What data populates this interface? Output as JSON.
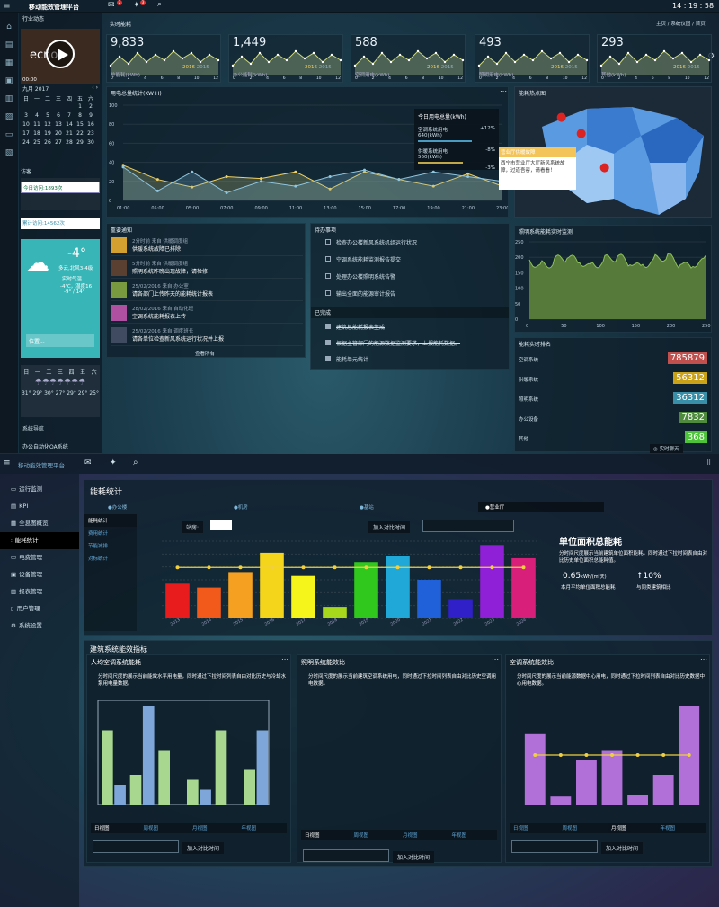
{
  "app": {
    "title": "移动能效管理平台",
    "time": "14 : 19 : 58",
    "mail_badge": "2",
    "sparkle_badge": "3"
  },
  "breadcrumb": {
    "home": "主页",
    "sys": "系统仪图",
    "cur": "首页"
  },
  "left": {
    "news_title": "行业动态",
    "video_time": "00:00",
    "video_label": "ecno",
    "video_sub": "the line",
    "cal_month": "九月 2017",
    "cal_head": [
      "日",
      "一",
      "二",
      "三",
      "四",
      "五",
      "六"
    ],
    "cal_rows": [
      [
        "",
        "",
        "",
        "",
        "",
        "1",
        "2"
      ],
      [
        "3",
        "4",
        "5",
        "6",
        "7",
        "8",
        "9"
      ],
      [
        "10",
        "11",
        "12",
        "13",
        "14",
        "15",
        "16"
      ],
      [
        "17",
        "18",
        "19",
        "20",
        "21",
        "22",
        "23"
      ],
      [
        "24",
        "25",
        "26",
        "27",
        "28",
        "29",
        "30"
      ]
    ],
    "visit_title": "访客",
    "visit_today": "今日访问:1893次",
    "visit_total": "累计访问:14562次",
    "weather_temp": "-4°",
    "weather_wind": "多云,北风3-4级",
    "weather_now": "实时气温",
    "weather_range": "-4℃，湿度16",
    "weather_aqi": "-9° / 14°",
    "location_ph": "位置...",
    "forecast_days": [
      "日",
      "一",
      "二",
      "三",
      "四",
      "五",
      "六"
    ],
    "forecast_temps": [
      "31°",
      "29°",
      "30°",
      "27°",
      "29°",
      "29°",
      "25°"
    ],
    "sys_nav": "系统导航",
    "oa": "办公自动化OA系统"
  },
  "realtime": {
    "title": "实时能耗",
    "cards": [
      {
        "num": "9,833",
        "unit": "总能耗(kWh)"
      },
      {
        "num": "1,449",
        "unit": "办公能耗(kWh)"
      },
      {
        "num": "588",
        "unit": "空调用电(kWh)"
      },
      {
        "num": "493",
        "unit": "照明用电(kWh)"
      },
      {
        "num": "293",
        "unit": "其他(kWh)"
      }
    ],
    "legend_a": "2016",
    "legend_b": "2015",
    "axis": [
      "0",
      "2",
      "4",
      "6",
      "8",
      "10",
      "12"
    ]
  },
  "elec": {
    "title": "用电总量统计(KW·H)",
    "ylabels": [
      "100",
      "80",
      "60",
      "40",
      "20",
      "0"
    ],
    "xlabels": [
      "01:00",
      "05:00",
      "05:00",
      "07:00",
      "09:00",
      "11:00",
      "13:00",
      "15:00",
      "17:00",
      "19:00",
      "21:00",
      "23:00"
    ],
    "tip_title": "今日用电总量(kWh)",
    "tip_a": "空调系统用电",
    "tip_a_val": "640(kWh)",
    "tip_a_pct": "+12%",
    "tip_b": "供暖系统用电",
    "tip_b_val": "560(kWh)",
    "tip_b_pct": "-8%",
    "tip_c_pct": "-3%"
  },
  "map": {
    "title": "能耗热点图",
    "pop_title": "营业厅供暖故障",
    "pop_body": "西宁市营业厅大厅新风系统故障，过道吾容，请看看！"
  },
  "notice": {
    "title": "重要通知",
    "more": "查看所有",
    "items": [
      {
        "meta": "2分时前 来自 供暖调度组",
        "text": "供暖系统故障已排除"
      },
      {
        "meta": "5分时前 来自 供暖调度组",
        "text": "照明系统昨晚出现故障，请检修"
      },
      {
        "meta": "25/02/2016 来自 办公室",
        "text": "请各部门上传昨天的能耗统计报表"
      },
      {
        "meta": "28/02/2016 来自 自动化班",
        "text": "空调系统能耗报表上传"
      },
      {
        "meta": "25/02/2016 来自 调度班长",
        "text": "请各单位检查新风系统运行状况并上报"
      }
    ]
  },
  "todo": {
    "title": "待办事项",
    "items": [
      "检查办公楼新风系统机组运行状况",
      "空调系统能耗监测报告提交",
      "处理办公楼照明系统告警",
      "输出全面的能源审计报告"
    ],
    "done_title": "已完成",
    "done": [
      "建筑总能耗报表生成",
      "根据主管部门的能源数据监测要求，上报能耗数据。",
      "能耗单元统计"
    ]
  },
  "light": {
    "title": "照明系统能耗实时监测",
    "y": [
      "250",
      "200",
      "150",
      "100",
      "50",
      "0"
    ],
    "x": [
      "0",
      "50",
      "100",
      "150",
      "200",
      "250"
    ]
  },
  "rank": {
    "title": "能耗实时排名",
    "items": [
      {
        "name": "空调系统",
        "val": "785879",
        "color": "#c0504d"
      },
      {
        "name": "供暖系统",
        "val": "56312",
        "color": "#c9a21a"
      },
      {
        "name": "照明系统",
        "val": "36312",
        "color": "#3a8fa8"
      },
      {
        "name": "办公设备",
        "val": "7832",
        "color": "#4f8a3f"
      },
      {
        "name": "其他",
        "val": "368",
        "color": "#4fc23c"
      }
    ],
    "live": "实时聊天"
  },
  "p2": {
    "title": "移动能效管理平台",
    "menu": [
      "运行监测",
      "KPI",
      "全息图概览",
      "能耗统计",
      "电费管理",
      "设备管理",
      "报表管理",
      "用户管理",
      "系统设置"
    ],
    "section": "能耗统计",
    "tabs": [
      "●办公楼",
      "●机房",
      "●基站",
      "●营业厅"
    ],
    "sub": [
      "能耗统计",
      "费用统计",
      "节能减排",
      "对标统计"
    ],
    "site_label": "站房:",
    "compare_btn": "加入对比时间",
    "bar_x": [
      "2013",
      "2014",
      "2015",
      "2016",
      "2017",
      "2018",
      "2019",
      "2020",
      "2021",
      "2022",
      "2023",
      "2024"
    ],
    "unit_title": "单位面积总能耗",
    "unit_desc": "分时间尺度展示当前建筑单位面积能耗。同时通过下拉时间表自由对比历史单位面积总能耗值。",
    "unit_val": "0.65",
    "unit_unit": "kWh/(m²天)",
    "unit_pct": "10%",
    "unit_cap1": "本月平均单位面积总能耗",
    "unit_cap2": "与同类建筑相比",
    "eff_title": "建筑系统能效指标",
    "eff": [
      {
        "title": "人均空调系统能耗",
        "desc": "分时间尺度的展示当前能效水平用电量，同时通过下拉时间列表自由对比历史与冷却水泵用电量数据。"
      },
      {
        "title": "照明系统能效比",
        "desc": "分时间尺度的展示当前建筑空调系统用电，同时通过下拉时间列表自由对比历史空调用电数据。"
      },
      {
        "title": "空调系统能效比",
        "desc": "分时间尺度的展示当前能源数据中心用电，同时通过下拉时间列表自由对比历史数据中心用电数据。"
      }
    ],
    "view_tabs": [
      "日视图",
      "周视图",
      "月视图",
      "年视图"
    ]
  },
  "chart_data": [
    {
      "type": "line",
      "title": "用电总量统计(KW·H)",
      "x": [
        "01:00",
        "03:00",
        "05:00",
        "07:00",
        "09:00",
        "11:00",
        "13:00",
        "15:00",
        "17:00",
        "19:00",
        "21:00",
        "23:00"
      ],
      "series": [
        {
          "values": [
            37,
            22,
            14,
            25,
            23,
            30,
            12,
            30,
            22,
            15,
            28,
            15
          ]
        },
        {
          "values": [
            35,
            10,
            30,
            8,
            20,
            15,
            25,
            32,
            22,
            30,
            25,
            20
          ]
        }
      ],
      "ylim": [
        0,
        100
      ]
    },
    {
      "type": "bar",
      "x": [
        "2013",
        "2014",
        "2015",
        "2016",
        "2017",
        "2018",
        "2019",
        "2020",
        "2021",
        "2022",
        "2023",
        "2024"
      ],
      "values": [
        45,
        40,
        60,
        85,
        55,
        15,
        73,
        81,
        50,
        25,
        95,
        78
      ],
      "line": [
        66,
        66,
        66,
        66,
        66,
        66,
        66,
        66,
        66,
        66,
        66,
        66
      ]
    },
    {
      "type": "bar",
      "title": "人均空调系统能耗",
      "series": [
        {
          "values": [
            75,
            30,
            55,
            25,
            75,
            35
          ]
        },
        {
          "values": [
            20,
            100,
            0,
            15,
            0,
            75
          ]
        }
      ]
    },
    {
      "type": "bar",
      "title": "空调系统能效比",
      "values": [
        72,
        8,
        45,
        55,
        10,
        30,
        100
      ],
      "line": [
        50,
        50,
        50,
        50,
        50,
        50,
        50
      ]
    }
  ]
}
